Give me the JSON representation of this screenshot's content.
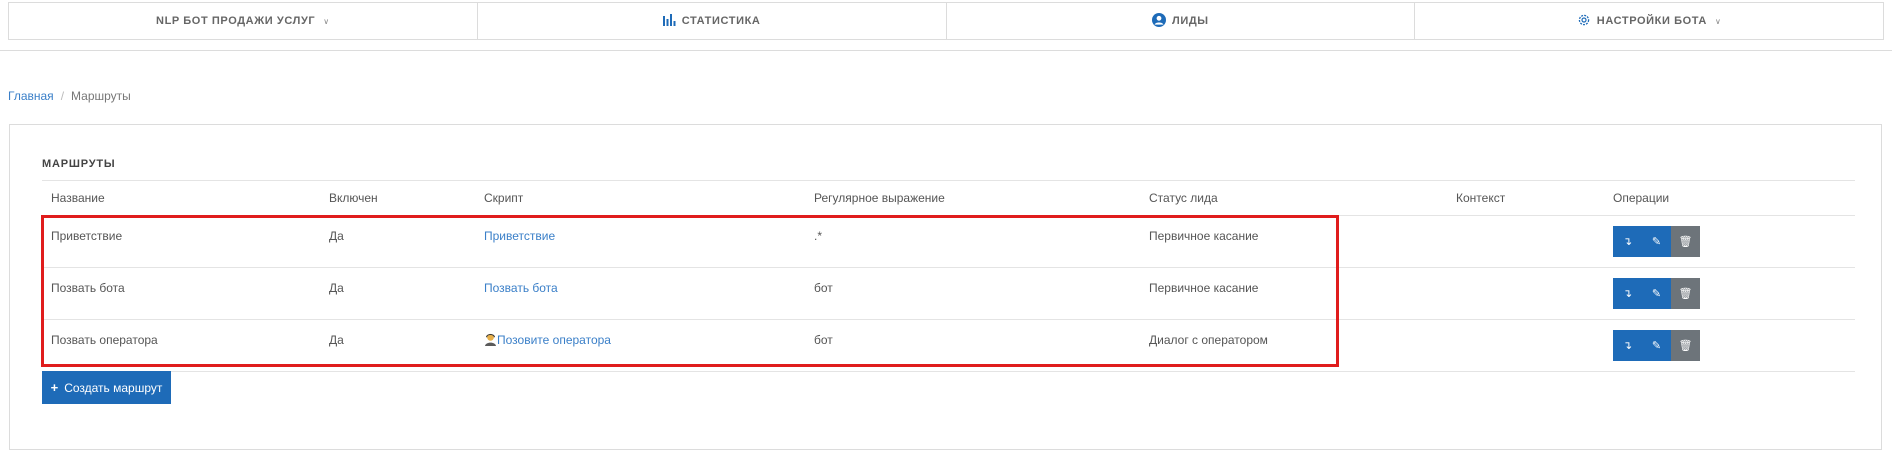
{
  "nav": {
    "items": [
      {
        "label": "NLP БОТ ПРОДАЖИ УСЛУГ",
        "icon": "",
        "dropdown": true
      },
      {
        "label": "СТАТИСТИКА",
        "icon": "bar-chart-icon",
        "dropdown": false
      },
      {
        "label": "ЛИДЫ",
        "icon": "user-circle-icon",
        "dropdown": false
      },
      {
        "label": "НАСТРОЙКИ БОТА",
        "icon": "gear-icon",
        "dropdown": true
      }
    ]
  },
  "breadcrumb": {
    "home": "Главная",
    "separator": "/",
    "current": "Маршруты"
  },
  "routes": {
    "title": "МАРШРУТЫ",
    "columns": [
      "Название",
      "Включен",
      "Скрипт",
      "Регулярное выражение",
      "Статус лида",
      "Контекст",
      "Операции"
    ],
    "rows": [
      {
        "name": "Приветствие",
        "enabled": "Да",
        "script": "Приветствие",
        "script_icon": "",
        "regex": ".*",
        "status": "Первичное касание",
        "context": ""
      },
      {
        "name": "Позвать бота",
        "enabled": "Да",
        "script": "Позвать бота",
        "script_icon": "",
        "regex": "бот",
        "status": "Первичное касание",
        "context": ""
      },
      {
        "name": "Позвать оператора",
        "enabled": "Да",
        "script": "Позовите оператора",
        "script_icon": "operator-icon",
        "regex": "бот",
        "status": "Диалог с оператором",
        "context": ""
      }
    ],
    "operations": [
      "move-icon",
      "edit-icon",
      "trash-icon"
    ],
    "create_label": "Создать маршрут"
  },
  "colors": {
    "accent": "#1e6bb8",
    "link": "#3a7fc8",
    "highlight": "#e01c1c",
    "delete": "#6d747a"
  }
}
